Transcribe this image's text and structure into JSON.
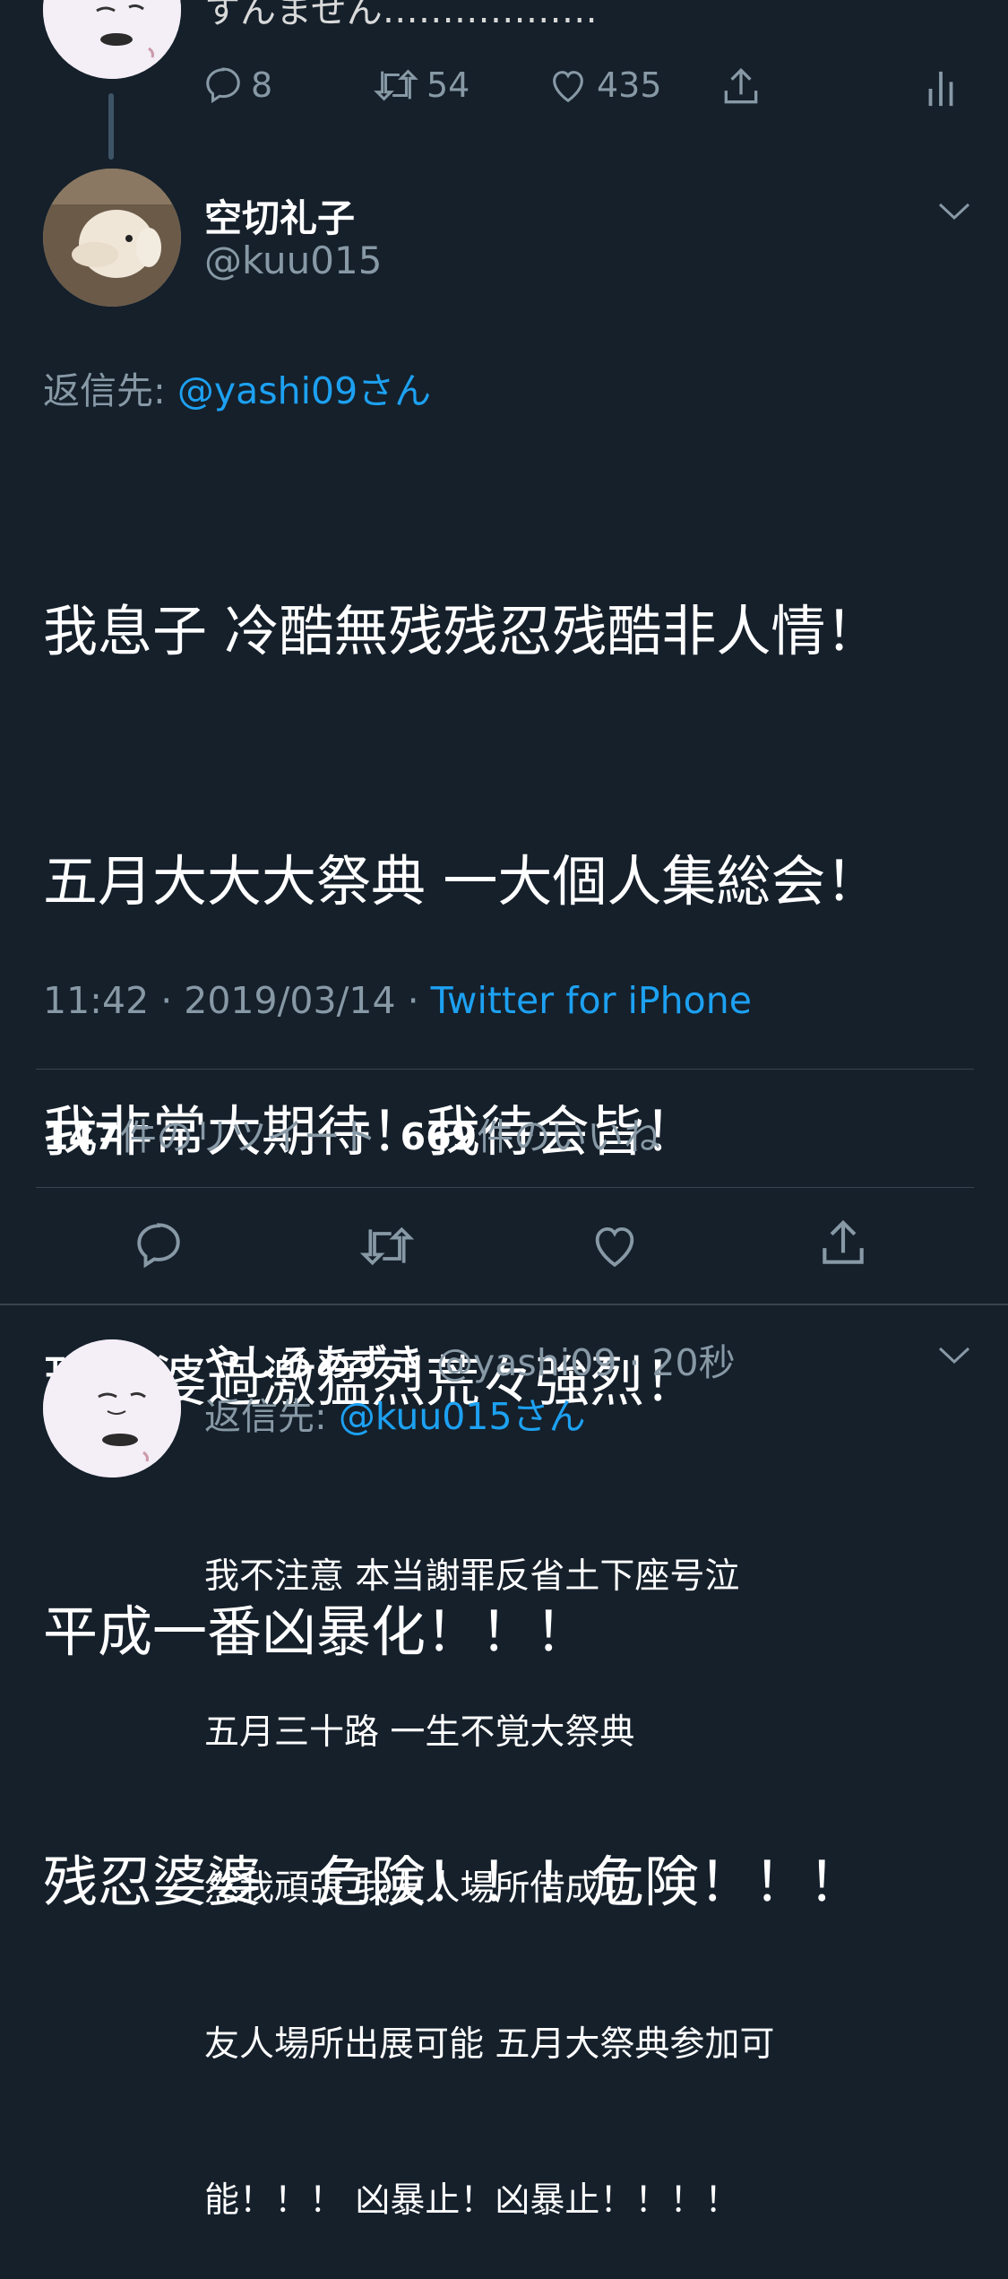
{
  "top_tweet": {
    "text": "すんません………………",
    "actions": {
      "replies": "8",
      "retweets": "54",
      "likes": "435"
    }
  },
  "main_tweet": {
    "name": "空切礼子",
    "handle": "@kuu015",
    "reply_label": "返信先: ",
    "reply_handle": "@yashi09さん",
    "lines": [
      "我息子 冷酷無残残忍残酷非人情！",
      "五月大大大祭典 一大個人集総会！",
      "我非常大期待！我待会皆！",
      "現婆婆過激猛烈荒々強烈！",
      "平成一番凶暴化！！！",
      "残忍婆婆　危険！！！危険！！！"
    ],
    "time": "11:42 · 2019/03/14 · ",
    "source": "Twitter for iPhone",
    "retweet_count": "147",
    "retweet_label": "件のリツイート",
    "like_count": "669",
    "like_label": "件のいいね"
  },
  "reply_tweet": {
    "name": "やしろあずき",
    "handle_time": " @yashi09 · 20秒",
    "reply_label": "返信先: ",
    "reply_handle": "@kuu015さん",
    "lines": [
      "我不注意 本当謝罪反省土下座号泣",
      "五月三十路 一生不覚大祭典",
      "然我頑張 我友人場所借成功",
      "友人場所出展可能 五月大祭典参加可",
      "能！！！ 凶暴止！凶暴止！！！！"
    ]
  },
  "colors": {
    "background": "#15202b",
    "accent": "#1da1f2",
    "muted": "#8899a6",
    "divider": "#38444d"
  }
}
